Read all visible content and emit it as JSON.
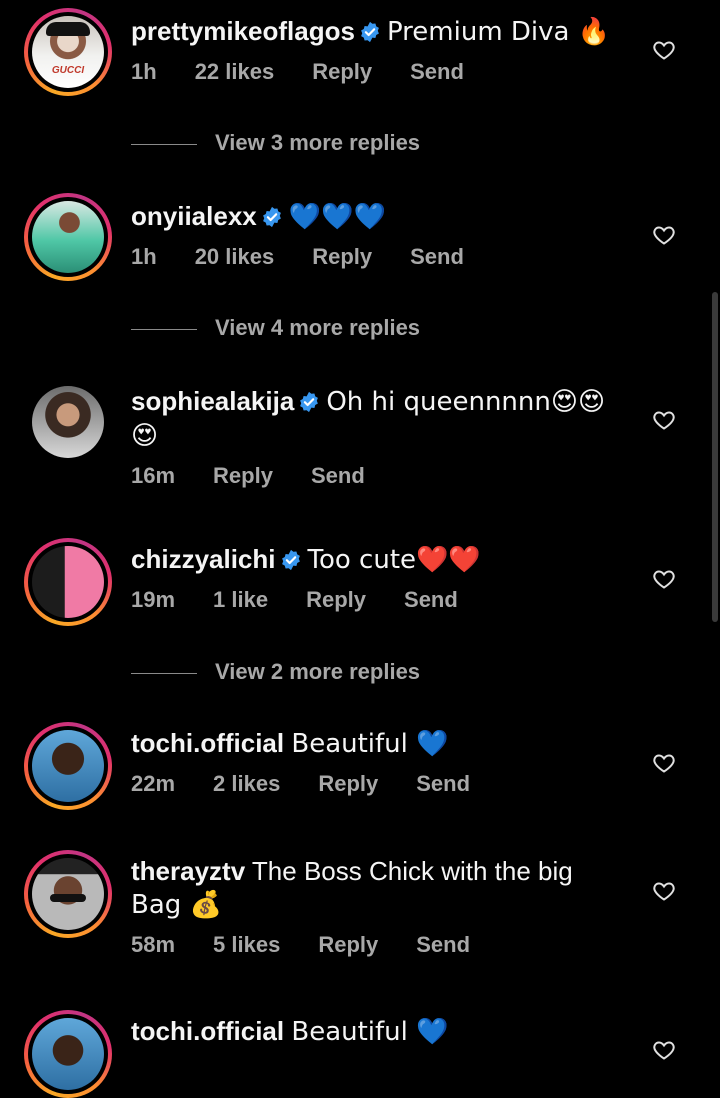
{
  "comments": [
    {
      "username": "prettymikeoflagos",
      "verified": true,
      "text_line1": "Premium Diva 🔥",
      "text_line2": "",
      "time": "1h",
      "likes": "22 likes",
      "reply": "Reply",
      "send": "Send",
      "avatar_text": "GUCCI"
    },
    {
      "username": "onyiialexx",
      "verified": true,
      "text_line1": "💙💙💙",
      "text_line2": "",
      "time": "1h",
      "likes": "20 likes",
      "reply": "Reply",
      "send": "Send"
    },
    {
      "username": "sophiealakija",
      "verified": true,
      "text_line1": "Oh hi queennnnn😍😍",
      "text_line2": "😍",
      "time": "16m",
      "likes": "",
      "reply": "Reply",
      "send": "Send"
    },
    {
      "username": "chizzyalichi",
      "verified": true,
      "text_line1": "Too cute❤️❤️",
      "text_line2": "",
      "time": "19m",
      "likes": "1 like",
      "reply": "Reply",
      "send": "Send"
    },
    {
      "username": "tochi.official",
      "verified": false,
      "text_line1": "Beautiful 💙",
      "text_line2": "",
      "time": "22m",
      "likes": "2 likes",
      "reply": "Reply",
      "send": "Send"
    },
    {
      "username": "therayztv",
      "verified": false,
      "text_line1": "The Boss Chick with the big",
      "text_line2": "Bag 💰",
      "time": "58m",
      "likes": "5 likes",
      "reply": "Reply",
      "send": "Send"
    },
    {
      "username": "tochi.official",
      "verified": false,
      "text_line1": "Beautiful 💙",
      "text_line2": "",
      "time": "",
      "likes": "",
      "reply": "",
      "send": ""
    }
  ],
  "view_more": [
    "View 3 more replies",
    "View 4 more replies",
    "View 2 more replies"
  ],
  "colors": {
    "background": "#000000",
    "text": "#f5f5f5",
    "secondary_text": "#a8a8a8",
    "verified_badge": "#3897f0"
  },
  "icons": {
    "verified": "verified-badge-icon",
    "like": "heart-outline-icon"
  }
}
